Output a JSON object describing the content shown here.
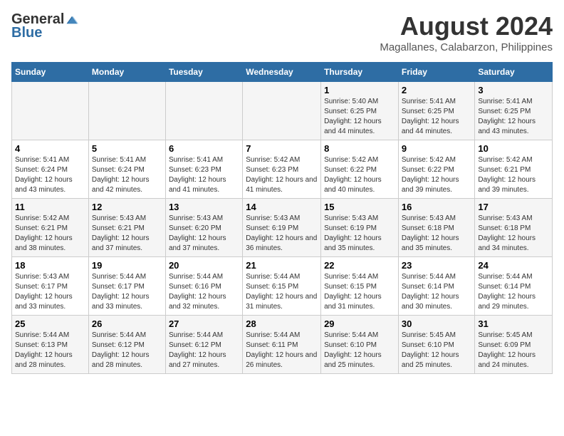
{
  "header": {
    "logo_general": "General",
    "logo_blue": "Blue",
    "month_title": "August 2024",
    "subtitle": "Magallanes, Calabarzon, Philippines"
  },
  "weekdays": [
    "Sunday",
    "Monday",
    "Tuesday",
    "Wednesday",
    "Thursday",
    "Friday",
    "Saturday"
  ],
  "weeks": [
    [
      {
        "day": "",
        "info": ""
      },
      {
        "day": "",
        "info": ""
      },
      {
        "day": "",
        "info": ""
      },
      {
        "day": "",
        "info": ""
      },
      {
        "day": "1",
        "info": "Sunrise: 5:40 AM\nSunset: 6:25 PM\nDaylight: 12 hours and 44 minutes."
      },
      {
        "day": "2",
        "info": "Sunrise: 5:41 AM\nSunset: 6:25 PM\nDaylight: 12 hours and 44 minutes."
      },
      {
        "day": "3",
        "info": "Sunrise: 5:41 AM\nSunset: 6:25 PM\nDaylight: 12 hours and 43 minutes."
      }
    ],
    [
      {
        "day": "4",
        "info": "Sunrise: 5:41 AM\nSunset: 6:24 PM\nDaylight: 12 hours and 43 minutes."
      },
      {
        "day": "5",
        "info": "Sunrise: 5:41 AM\nSunset: 6:24 PM\nDaylight: 12 hours and 42 minutes."
      },
      {
        "day": "6",
        "info": "Sunrise: 5:41 AM\nSunset: 6:23 PM\nDaylight: 12 hours and 41 minutes."
      },
      {
        "day": "7",
        "info": "Sunrise: 5:42 AM\nSunset: 6:23 PM\nDaylight: 12 hours and 41 minutes."
      },
      {
        "day": "8",
        "info": "Sunrise: 5:42 AM\nSunset: 6:22 PM\nDaylight: 12 hours and 40 minutes."
      },
      {
        "day": "9",
        "info": "Sunrise: 5:42 AM\nSunset: 6:22 PM\nDaylight: 12 hours and 39 minutes."
      },
      {
        "day": "10",
        "info": "Sunrise: 5:42 AM\nSunset: 6:21 PM\nDaylight: 12 hours and 39 minutes."
      }
    ],
    [
      {
        "day": "11",
        "info": "Sunrise: 5:42 AM\nSunset: 6:21 PM\nDaylight: 12 hours and 38 minutes."
      },
      {
        "day": "12",
        "info": "Sunrise: 5:43 AM\nSunset: 6:21 PM\nDaylight: 12 hours and 37 minutes."
      },
      {
        "day": "13",
        "info": "Sunrise: 5:43 AM\nSunset: 6:20 PM\nDaylight: 12 hours and 37 minutes."
      },
      {
        "day": "14",
        "info": "Sunrise: 5:43 AM\nSunset: 6:19 PM\nDaylight: 12 hours and 36 minutes."
      },
      {
        "day": "15",
        "info": "Sunrise: 5:43 AM\nSunset: 6:19 PM\nDaylight: 12 hours and 35 minutes."
      },
      {
        "day": "16",
        "info": "Sunrise: 5:43 AM\nSunset: 6:18 PM\nDaylight: 12 hours and 35 minutes."
      },
      {
        "day": "17",
        "info": "Sunrise: 5:43 AM\nSunset: 6:18 PM\nDaylight: 12 hours and 34 minutes."
      }
    ],
    [
      {
        "day": "18",
        "info": "Sunrise: 5:43 AM\nSunset: 6:17 PM\nDaylight: 12 hours and 33 minutes."
      },
      {
        "day": "19",
        "info": "Sunrise: 5:44 AM\nSunset: 6:17 PM\nDaylight: 12 hours and 33 minutes."
      },
      {
        "day": "20",
        "info": "Sunrise: 5:44 AM\nSunset: 6:16 PM\nDaylight: 12 hours and 32 minutes."
      },
      {
        "day": "21",
        "info": "Sunrise: 5:44 AM\nSunset: 6:15 PM\nDaylight: 12 hours and 31 minutes."
      },
      {
        "day": "22",
        "info": "Sunrise: 5:44 AM\nSunset: 6:15 PM\nDaylight: 12 hours and 31 minutes."
      },
      {
        "day": "23",
        "info": "Sunrise: 5:44 AM\nSunset: 6:14 PM\nDaylight: 12 hours and 30 minutes."
      },
      {
        "day": "24",
        "info": "Sunrise: 5:44 AM\nSunset: 6:14 PM\nDaylight: 12 hours and 29 minutes."
      }
    ],
    [
      {
        "day": "25",
        "info": "Sunrise: 5:44 AM\nSunset: 6:13 PM\nDaylight: 12 hours and 28 minutes."
      },
      {
        "day": "26",
        "info": "Sunrise: 5:44 AM\nSunset: 6:12 PM\nDaylight: 12 hours and 28 minutes."
      },
      {
        "day": "27",
        "info": "Sunrise: 5:44 AM\nSunset: 6:12 PM\nDaylight: 12 hours and 27 minutes."
      },
      {
        "day": "28",
        "info": "Sunrise: 5:44 AM\nSunset: 6:11 PM\nDaylight: 12 hours and 26 minutes."
      },
      {
        "day": "29",
        "info": "Sunrise: 5:44 AM\nSunset: 6:10 PM\nDaylight: 12 hours and 25 minutes."
      },
      {
        "day": "30",
        "info": "Sunrise: 5:45 AM\nSunset: 6:10 PM\nDaylight: 12 hours and 25 minutes."
      },
      {
        "day": "31",
        "info": "Sunrise: 5:45 AM\nSunset: 6:09 PM\nDaylight: 12 hours and 24 minutes."
      }
    ]
  ]
}
